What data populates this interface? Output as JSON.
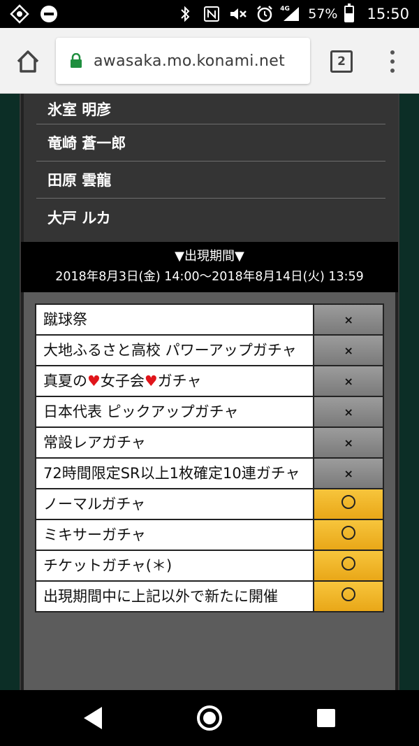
{
  "status_bar": {
    "battery_percent": "57%",
    "battery_level": 0.57,
    "time": "15:50",
    "signal_label": "4G",
    "icons": [
      "app-icon",
      "dnd-icon",
      "bluetooth-icon",
      "nfc-icon",
      "mute-icon",
      "alarm-icon",
      "signal-icon",
      "battery-icon"
    ]
  },
  "browser": {
    "url": "awasaka.mo.konami.net",
    "tab_count": "2",
    "accent_lock_color": "#1e8e3e"
  },
  "names": [
    "氷室 明彦",
    "竜崎 蒼一郎",
    "田原 雲龍",
    "大戸 ルカ"
  ],
  "period": {
    "title": "▼出現期間▼",
    "range": "2018年8月3日(金) 14:00～2018年8月14日(火) 13:59"
  },
  "gacha_table": [
    {
      "name": "蹴球祭",
      "mark": "×"
    },
    {
      "name": "大地ふるさと高校 パワーアップガチャ",
      "mark": "×"
    },
    {
      "name_before": "真夏の",
      "heart1": "♥",
      "name_mid": "女子会",
      "heart2": "♥",
      "name_after": "ガチャ",
      "mark": "×"
    },
    {
      "name": "日本代表 ピックアップガチャ",
      "mark": "×"
    },
    {
      "name": "常設レアガチャ",
      "mark": "×"
    },
    {
      "name": "72時間限定SR以上1枚確定10連ガチャ",
      "mark": "×"
    },
    {
      "name": "ノーマルガチャ",
      "mark": "○"
    },
    {
      "name": "ミキサーガチャ",
      "mark": "○"
    },
    {
      "name": "チケットガチャ(＊)",
      "mark": "○"
    },
    {
      "name": "出現期間中に上記以外で新たに開催",
      "mark": "○"
    }
  ],
  "colors": {
    "unavailable_cell": "#8a8a8a",
    "available_cell": "#f2b62a",
    "page_background": "#0c2e26"
  }
}
